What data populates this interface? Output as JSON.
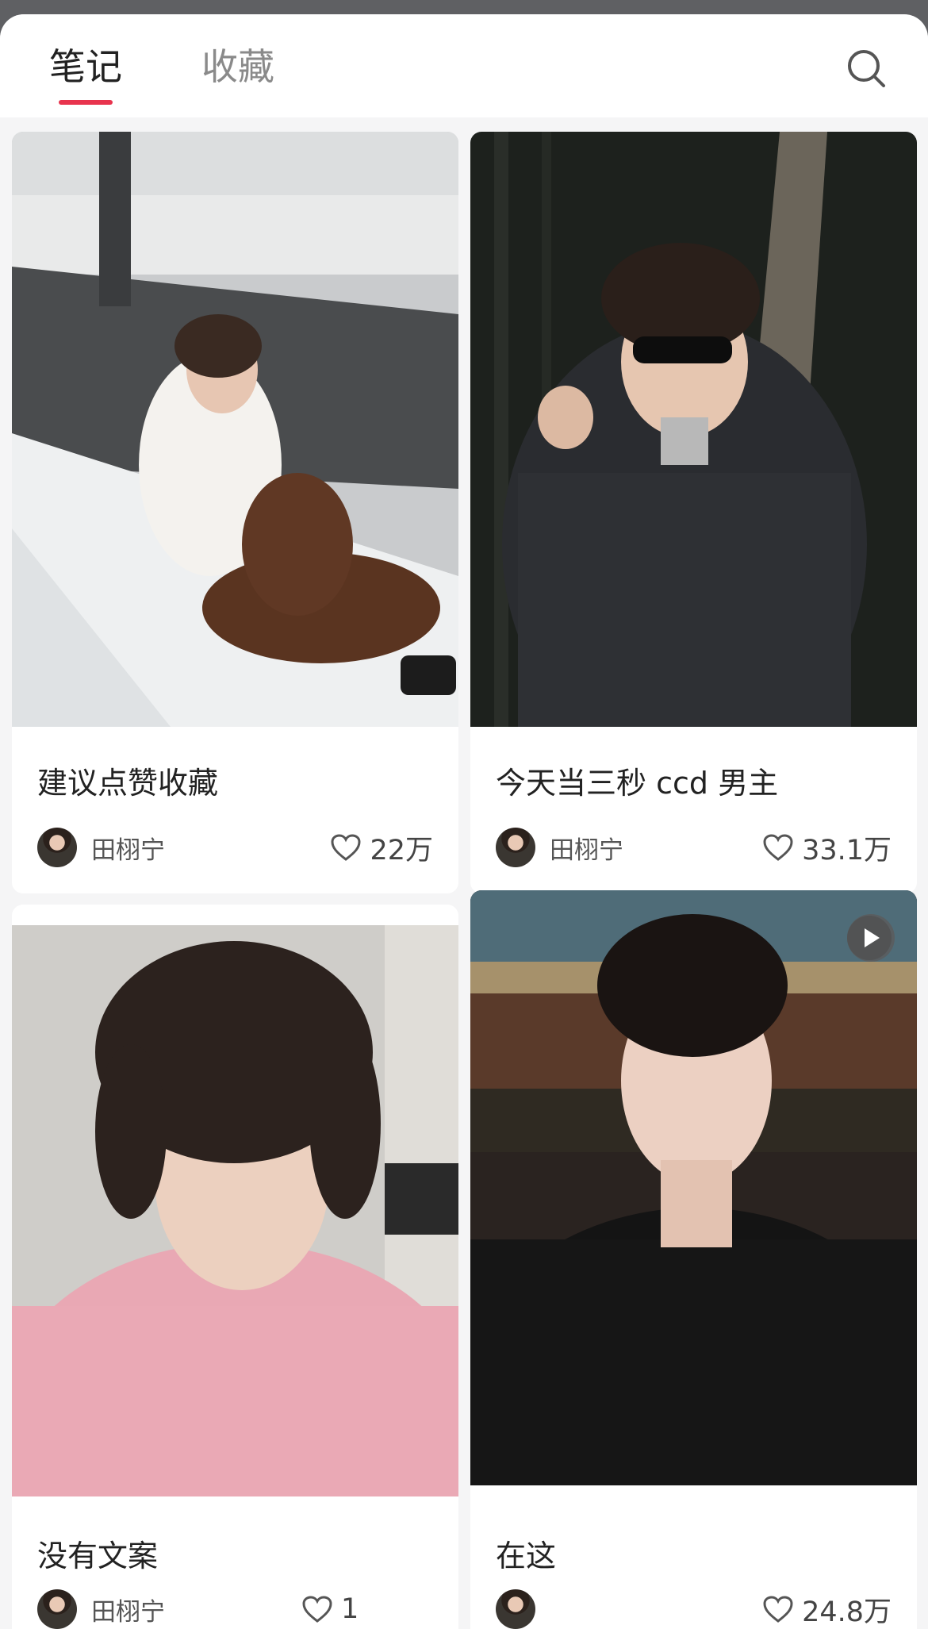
{
  "tabs": [
    {
      "label": "笔记",
      "active": true
    },
    {
      "label": "收藏",
      "active": false
    }
  ],
  "colors": {
    "accent": "#e8344e"
  },
  "search": {
    "icon": "search-icon"
  },
  "notes": [
    {
      "title": "建议点赞收藏",
      "author": "田栩宁",
      "likes": "22万",
      "type": "image"
    },
    {
      "title": "今天当三秒 ccd 男主",
      "author": "田栩宁",
      "likes": "33.1万",
      "type": "image"
    },
    {
      "title": "没有文案",
      "author": "田栩宁",
      "likes": "1",
      "type": "image"
    },
    {
      "title": "在这",
      "author": "",
      "likes": "24.8万",
      "type": "video"
    }
  ]
}
